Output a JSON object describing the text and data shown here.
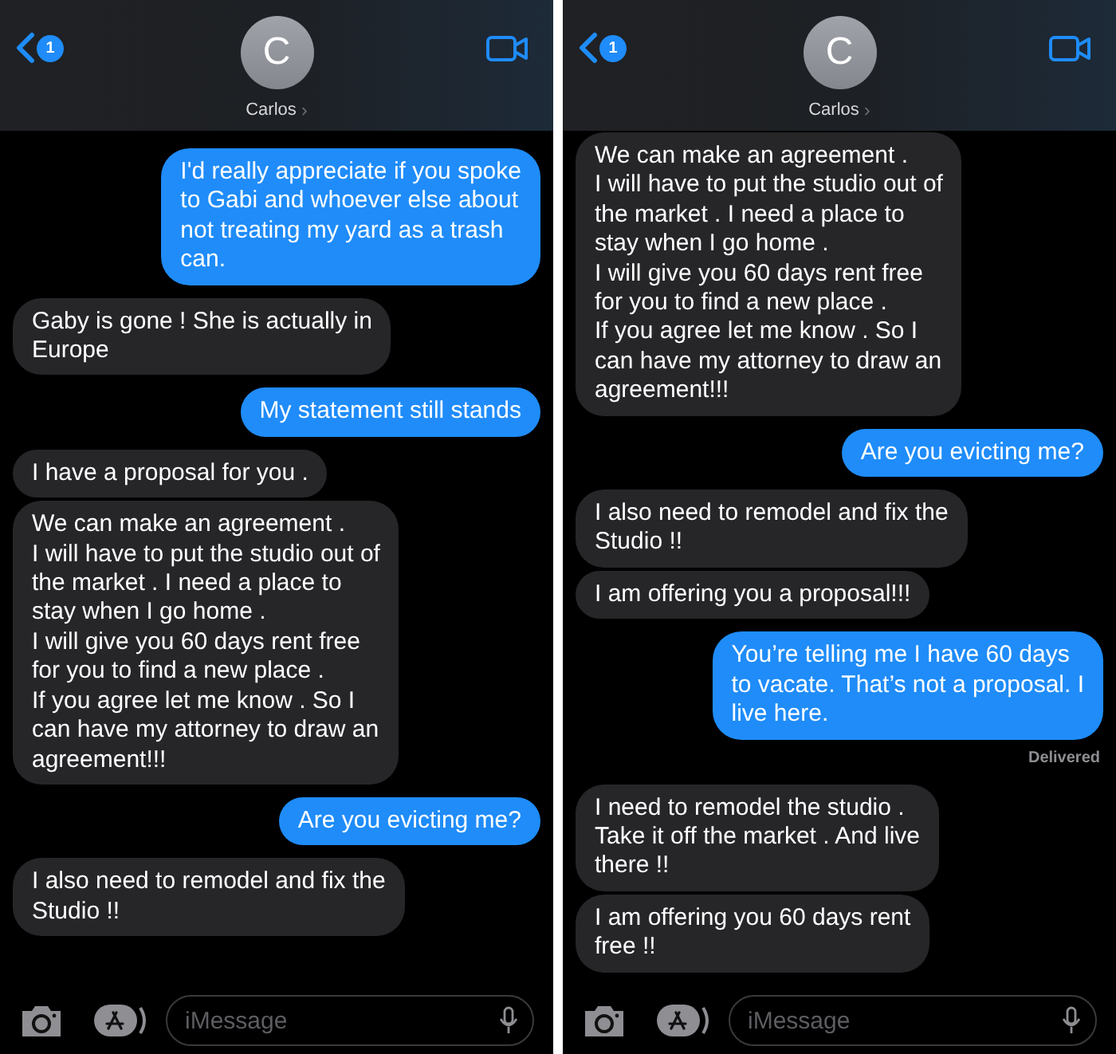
{
  "panels": [
    {
      "header": {
        "back_badge": "1",
        "avatar_initial": "C",
        "contact_name": "Carlos",
        "chevron": "›"
      },
      "messages": [
        {
          "kind": "sent",
          "text": "I'd really appreciate if you spoke\nto Gabi and whoever else about\nnot treating my yard as a trash\ncan."
        },
        {
          "kind": "received",
          "text": "Gaby is gone ! She is actually in\nEurope"
        },
        {
          "kind": "sent",
          "text": "My statement still stands"
        },
        {
          "kind": "received",
          "text": "I have a proposal for you .\n "
        },
        {
          "kind": "received",
          "text": "We can make an agreement .\nI will have to put the studio out of\nthe market . I need a place to\nstay when I go home .\nI will give you 60 days rent free\nfor you to find a new place .\nIf you agree let me know . So I\ncan have my attorney to draw an\nagreement!!!"
        },
        {
          "kind": "sent",
          "text": "Are you evicting me?"
        },
        {
          "kind": "received",
          "text": "I also need to remodel and fix the\nStudio !!"
        }
      ],
      "composer": {
        "placeholder": "iMessage"
      }
    },
    {
      "header": {
        "back_badge": "1",
        "avatar_initial": "C",
        "contact_name": "Carlos",
        "chevron": "›"
      },
      "messages": [
        {
          "kind": "received",
          "text": "We can make an agreement .\nI will have to put the studio out of\nthe market . I need a place to\nstay when I go home .\nI will give you 60 days rent free\nfor you to find a new place .\nIf you agree let me know . So I\ncan have my attorney to draw an\nagreement!!!"
        },
        {
          "kind": "sent",
          "text": "Are you evicting me?"
        },
        {
          "kind": "received",
          "text": "I also need to remodel and fix the\nStudio !!"
        },
        {
          "kind": "received",
          "text": "I am offering you a proposal!!!"
        },
        {
          "kind": "sent",
          "text": "You’re telling me I have 60 days\nto vacate. That’s not a proposal. I\nlive here.",
          "status": "Delivered"
        },
        {
          "kind": "received",
          "text": "I need to  remodel the studio .\nTake it off the market . And live\nthere !!"
        },
        {
          "kind": "received",
          "text": "I am offering you 60 days rent\nfree !!"
        }
      ],
      "composer": {
        "placeholder": "iMessage"
      }
    }
  ]
}
